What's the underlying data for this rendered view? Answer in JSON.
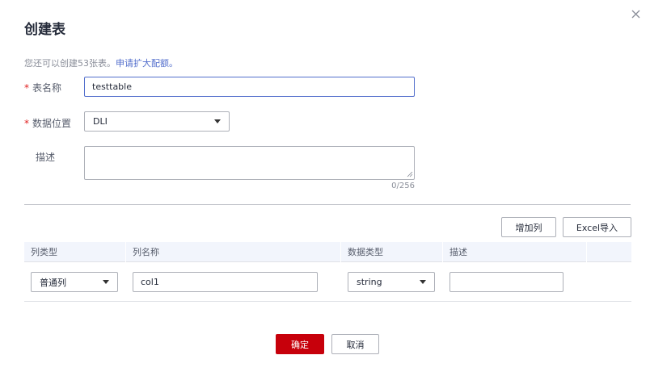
{
  "dialog": {
    "title": "创建表",
    "quota_text": "您还可以创建53张表。",
    "quota_link": "申请扩大配额。"
  },
  "form": {
    "required_mark": "*",
    "table_name_label": "表名称",
    "table_name_value": "testtable",
    "location_label": "数据位置",
    "location_value": "DLI",
    "description_label": "描述",
    "description_value": "",
    "description_count": "0/256"
  },
  "columns": {
    "add_button": "增加列",
    "import_button": "Excel导入",
    "headers": [
      "列类型",
      "列名称",
      "数据类型",
      "描述",
      ""
    ],
    "rows": [
      {
        "column_type": "普通列",
        "column_name": "col1",
        "data_type": "string",
        "description": ""
      }
    ]
  },
  "footer": {
    "confirm_label": "确定",
    "cancel_label": "取消"
  },
  "icons": {
    "close": "close-icon",
    "dropdown": "chevron-down-icon",
    "resize": "resize-grip-icon"
  },
  "colors": {
    "primary": "#c7000b",
    "link": "#526ecc",
    "required": "#e02020",
    "focus_border": "#526ecc"
  }
}
